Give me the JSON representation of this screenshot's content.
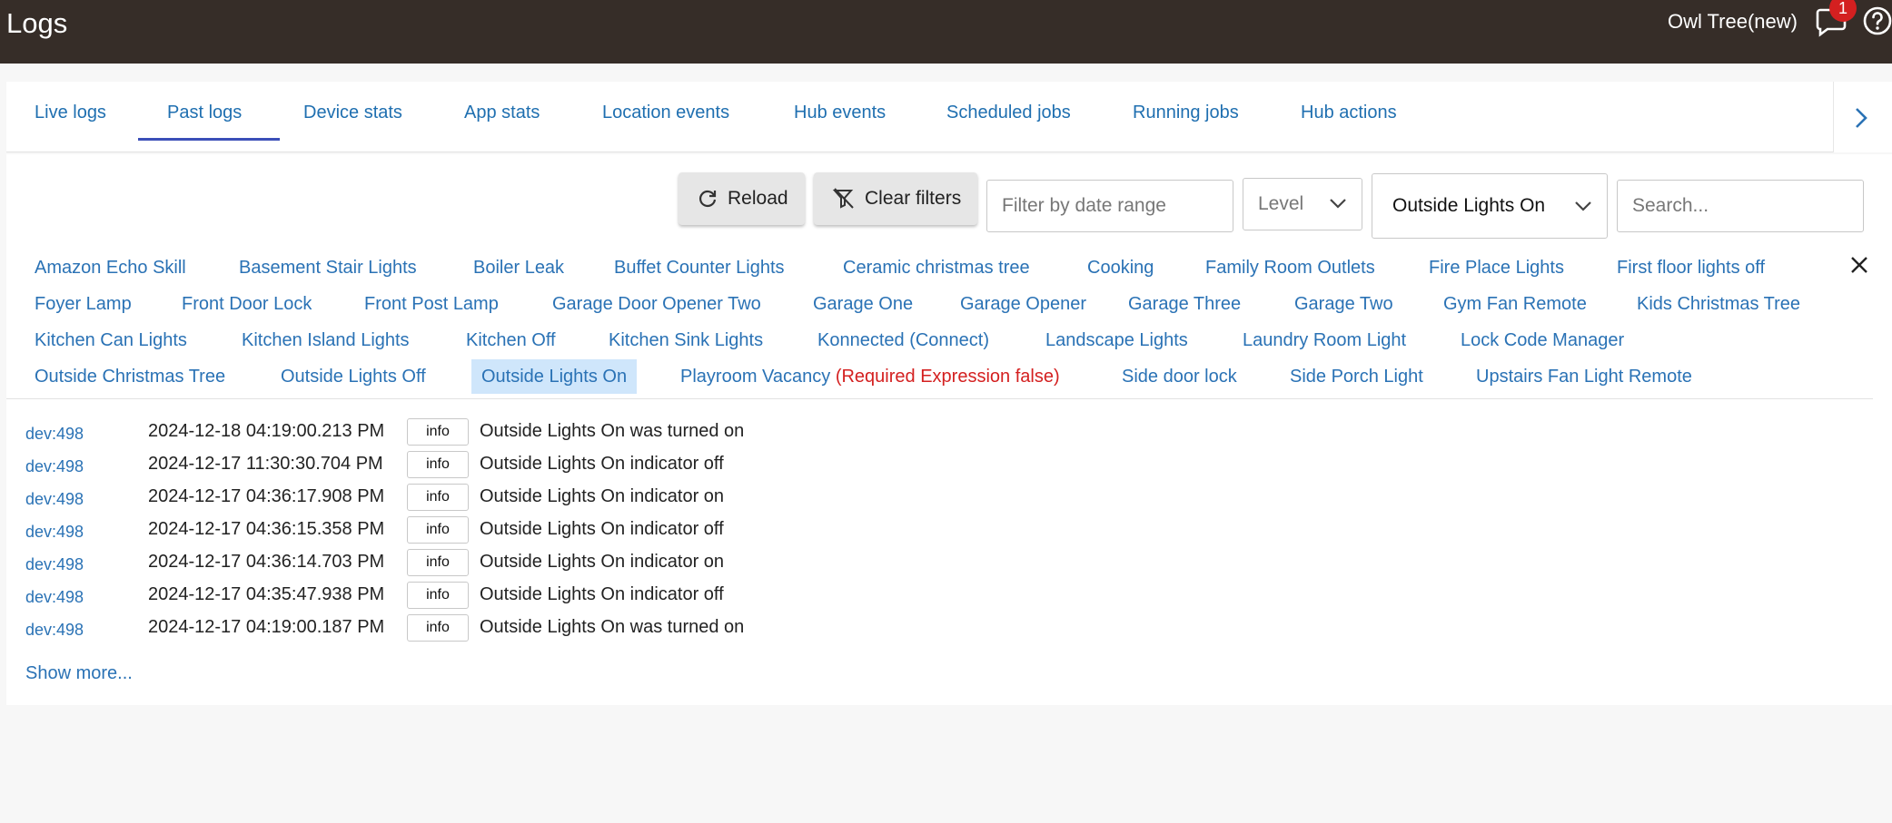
{
  "header": {
    "title": "Logs",
    "hub_name": "Owl Tree(new)",
    "notification_count": "1"
  },
  "tabs": [
    {
      "label": "Live logs",
      "active": false
    },
    {
      "label": "Past logs",
      "active": true
    },
    {
      "label": "Device stats",
      "active": false
    },
    {
      "label": "App stats",
      "active": false
    },
    {
      "label": "Location events",
      "active": false
    },
    {
      "label": "Hub events",
      "active": false
    },
    {
      "label": "Scheduled jobs",
      "active": false
    },
    {
      "label": "Running jobs",
      "active": false
    },
    {
      "label": "Hub actions",
      "active": false
    }
  ],
  "toolbar": {
    "reload_label": "Reload",
    "clear_filters_label": "Clear filters",
    "date_range_placeholder": "Filter by date range",
    "level_label": "Level",
    "source_selected": "Outside Lights On",
    "search_placeholder": "Search..."
  },
  "filters": [
    "Amazon Echo Skill",
    "Basement Stair Lights",
    "Boiler Leak",
    "Buffet Counter Lights",
    "Ceramic christmas tree",
    "Cooking",
    "Family Room Outlets",
    "Fire Place Lights",
    "First floor lights off",
    "Foyer Lamp",
    "Front Door Lock",
    "Front Post Lamp",
    "Garage Door Opener Two",
    "Garage One",
    "Garage Opener",
    "Garage Three",
    "Garage Two",
    "Gym Fan Remote",
    "Kids Christmas Tree",
    "Kitchen Can Lights",
    "Kitchen Island Lights",
    "Kitchen Off",
    "Kitchen Sink Lights",
    "Konnected (Connect)",
    "Landscape Lights",
    "Laundry Room Light",
    "Lock Code Manager",
    "Outside Christmas Tree",
    "Outside Lights Off",
    "Outside Lights On",
    "Playroom Vacancy",
    "Side door lock",
    "Side Porch Light",
    "Upstairs Fan Light Remote"
  ],
  "filters_selected": "Outside Lights On",
  "playroom_suffix": "(Required Expression false)",
  "logs": [
    {
      "dev": "dev:498",
      "time": "2024-12-18 04:19:00.213 PM",
      "level": "info",
      "message": "Outside Lights On was turned on"
    },
    {
      "dev": "dev:498",
      "time": "2024-12-17 11:30:30.704 PM",
      "level": "info",
      "message": "Outside Lights On indicator off"
    },
    {
      "dev": "dev:498",
      "time": "2024-12-17 04:36:17.908 PM",
      "level": "info",
      "message": "Outside Lights On indicator on"
    },
    {
      "dev": "dev:498",
      "time": "2024-12-17 04:36:15.358 PM",
      "level": "info",
      "message": "Outside Lights On indicator off"
    },
    {
      "dev": "dev:498",
      "time": "2024-12-17 04:36:14.703 PM",
      "level": "info",
      "message": "Outside Lights On indicator on"
    },
    {
      "dev": "dev:498",
      "time": "2024-12-17 04:35:47.938 PM",
      "level": "info",
      "message": "Outside Lights On indicator off"
    },
    {
      "dev": "dev:498",
      "time": "2024-12-17 04:19:00.187 PM",
      "level": "info",
      "message": "Outside Lights On was turned on"
    }
  ],
  "show_more_label": "Show more...",
  "colors": {
    "header_bg": "#362d28",
    "link": "#2a72b5",
    "selected_chip_bg": "#cfe6fb",
    "warning": "#d42020",
    "badge": "#d42020"
  }
}
